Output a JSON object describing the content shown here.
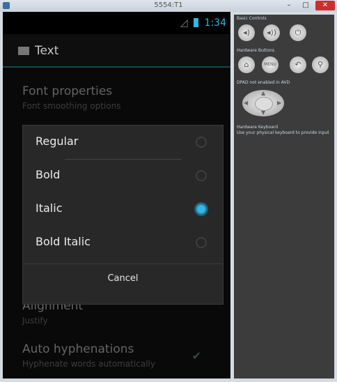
{
  "window": {
    "title": "5554:T1"
  },
  "status_bar": {
    "time": "1:34"
  },
  "action_bar": {
    "title": "Text"
  },
  "preferences": [
    {
      "title": "Font properties",
      "summary": "Font smoothing options"
    },
    {
      "title": "Alignment",
      "summary": "Justify"
    },
    {
      "title": "Auto hyphenations",
      "summary": "Hyphenate words automatically",
      "checked": true
    }
  ],
  "dialog": {
    "options": [
      {
        "label": "Regular",
        "selected": false
      },
      {
        "label": "Bold",
        "selected": false
      },
      {
        "label": "Italic",
        "selected": true
      },
      {
        "label": "Bold Italic",
        "selected": false
      }
    ],
    "cancel_label": "Cancel"
  },
  "side_panel": {
    "basic_controls_label": "Basic Controls",
    "hardware_buttons_label": "Hardware Buttons",
    "dpad_label": "DPAD not enabled in AVD",
    "keyboard_label": "Hardware Keyboard",
    "keyboard_note": "Use your physical keyboard to provide input",
    "menu_label": "MENU"
  },
  "colors": {
    "accent": "#33b5e5",
    "divider": "#1f6f8b"
  }
}
